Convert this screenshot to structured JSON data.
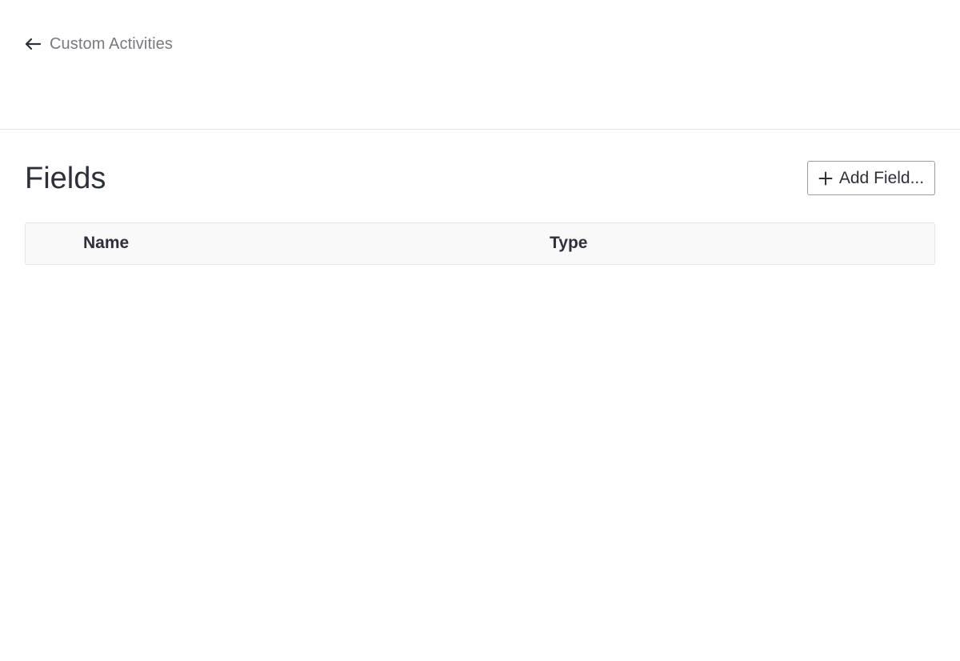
{
  "nav": {
    "back_label": "Custom Activities",
    "back_icon": "arrow-left-icon"
  },
  "section": {
    "title": "Fields"
  },
  "toolbar": {
    "add_field_label": "Add Field...",
    "add_field_icon": "plus-icon"
  },
  "table": {
    "columns": [
      "Name",
      "Type"
    ],
    "rows": []
  },
  "colors": {
    "text": "#2d3038",
    "muted_text": "#777a80",
    "divider": "#dfe1e4",
    "header_bg": "#f9f9f9",
    "button_border": "#9a9ca1"
  }
}
